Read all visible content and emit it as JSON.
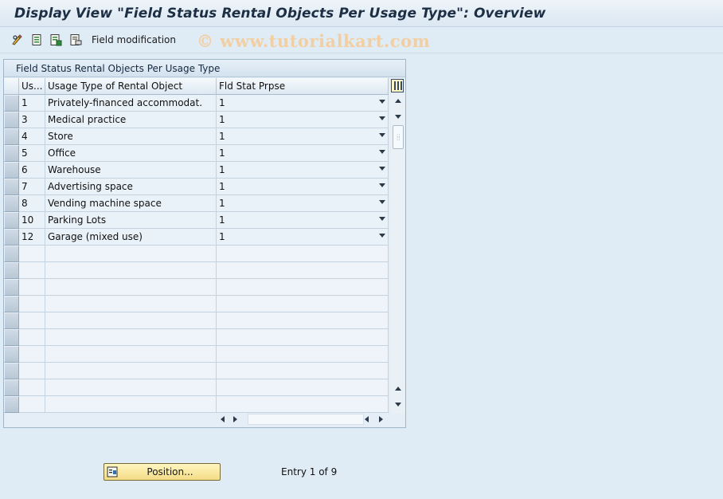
{
  "window": {
    "title": "Display View \"Field Status Rental Objects Per Usage Type\": Overview"
  },
  "toolbar": {
    "icons": [
      "edit-glasses-icon",
      "details-icon",
      "save-list-icon",
      "print-list-icon"
    ],
    "field_modification_label": "Field modification"
  },
  "watermark": "© www.tutorialkart.com",
  "table": {
    "title": "Field Status Rental Objects Per Usage Type",
    "columns": [
      "Us...",
      "Usage Type of Rental Object",
      "Fld Stat Prpse"
    ],
    "rows": [
      {
        "code": "1",
        "usage_type": "Privately-financed accommodat.",
        "fld_stat": "1"
      },
      {
        "code": "3",
        "usage_type": "Medical practice",
        "fld_stat": "1"
      },
      {
        "code": "4",
        "usage_type": "Store",
        "fld_stat": "1"
      },
      {
        "code": "5",
        "usage_type": "Office",
        "fld_stat": "1"
      },
      {
        "code": "6",
        "usage_type": "Warehouse",
        "fld_stat": "1"
      },
      {
        "code": "7",
        "usage_type": "Advertising space",
        "fld_stat": "1"
      },
      {
        "code": "8",
        "usage_type": "Vending machine space",
        "fld_stat": "1"
      },
      {
        "code": "10",
        "usage_type": "Parking Lots",
        "fld_stat": "1"
      },
      {
        "code": "12",
        "usage_type": "Garage (mixed use)",
        "fld_stat": "1"
      }
    ],
    "empty_rows": 10
  },
  "footer": {
    "position_button": "Position...",
    "entry_text": "Entry 1 of 9"
  },
  "colors": {
    "background": "#dfebf5",
    "title_text": "#1d2f45",
    "button_yellow": "#f4dc85",
    "watermark": "#f2cfa3"
  }
}
